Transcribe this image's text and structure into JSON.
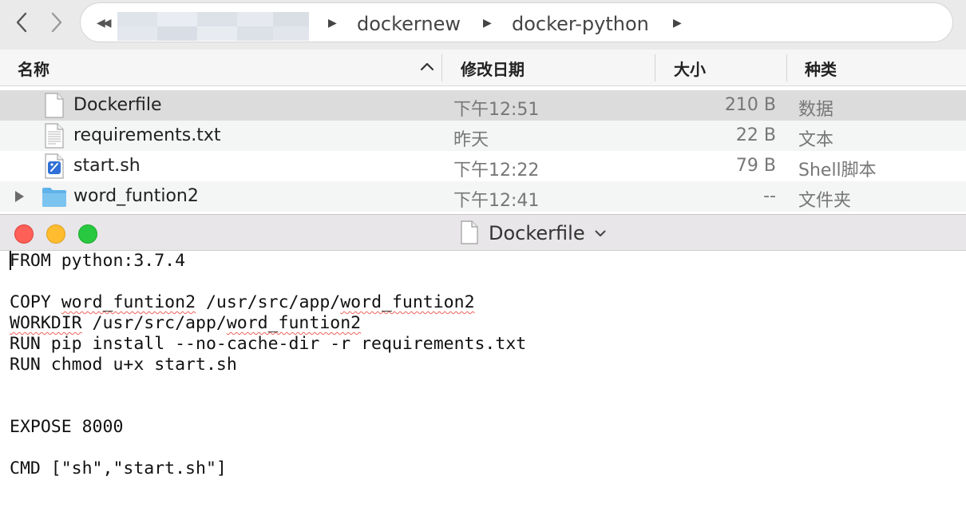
{
  "finder": {
    "path": {
      "crumbs": [
        "dockernew",
        "docker-python"
      ]
    },
    "columns": {
      "name": "名称",
      "date": "修改日期",
      "size": "大小",
      "kind": "种类"
    },
    "rows": [
      {
        "name": "Dockerfile",
        "date": "下午12:51",
        "size": "210 B",
        "kind": "数据",
        "icon": "document-icon",
        "selected": true
      },
      {
        "name": "requirements.txt",
        "date": "昨天",
        "size": "22 B",
        "kind": "文本",
        "icon": "text-file-icon"
      },
      {
        "name": "start.sh",
        "date": "下午12:22",
        "size": "79 B",
        "kind": "Shell脚本",
        "icon": "shell-script-icon"
      },
      {
        "name": "word_funtion2",
        "date": "下午12:41",
        "size": "--",
        "kind": "文件夹",
        "icon": "folder-icon"
      }
    ]
  },
  "editor": {
    "title": "Dockerfile",
    "lines": [
      "FROM python:3.7.4",
      "",
      "COPY word_funtion2 /usr/src/app/word_funtion2",
      "WORKDIR /usr/src/app/word_funtion2",
      "RUN pip install --no-cache-dir -r requirements.txt",
      "RUN chmod u+x start.sh",
      "",
      "",
      "EXPOSE 8000",
      "",
      "CMD [\"sh\",\"start.sh\"]"
    ]
  },
  "colors": {
    "selected_row": "#dcdcdc",
    "alt_row": "#f4f5f5",
    "folder_blue": "#5fb3ea",
    "close": "#fe5f57",
    "minimize": "#febc2e",
    "zoom": "#28c840",
    "spellcheck": "#f0605a"
  }
}
